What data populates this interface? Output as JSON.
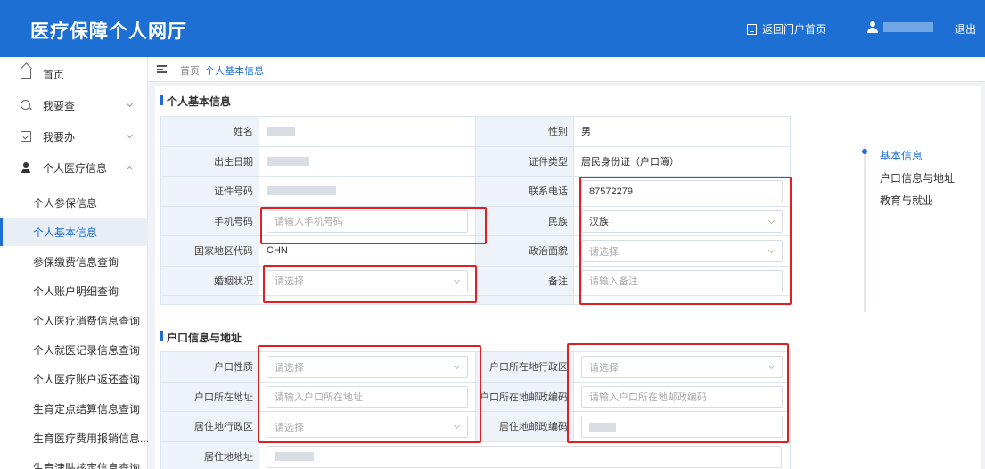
{
  "header": {
    "title": "医疗保障个人网厅",
    "portal_link": "返回门户首页",
    "logout": "退出",
    "bg_color": "#1d6fd3"
  },
  "sidebar": {
    "home": "首页",
    "query": "我要查",
    "handle": "我要办",
    "medical_info": "个人医疗信息",
    "sub_items": [
      "个人参保信息",
      "个人基本信息",
      "参保缴费信息查询",
      "个人账户明细查询",
      "个人医疗消费信息查询",
      "个人就医记录信息查询",
      "个人医疗账户返还查询",
      "生育定点结算信息查询",
      "生育医疗费用报销信息...",
      "生育津贴核定信息查询"
    ],
    "active_index": 1
  },
  "tabs": {
    "home": "首页",
    "active": "个人基本信息",
    "close": "×"
  },
  "basic": {
    "title": "个人基本信息",
    "name_label": "姓名",
    "gender_label": "性别",
    "gender_value": "男",
    "birth_label": "出生日期",
    "cert_type_label": "证件类型",
    "cert_type_value": "居民身份证（户口簿）",
    "cert_no_label": "证件号码",
    "phone_label": "联系电话",
    "phone_value": "87572279",
    "mobile_label": "手机号码",
    "mobile_placeholder": "请输入手机号码",
    "ethnic_label": "民族",
    "ethnic_value": "汉族",
    "country_label": "国家地区代码",
    "country_value": "CHN",
    "political_label": "政治面貌",
    "political_placeholder": "请选择",
    "marital_label": "婚姻状况",
    "marital_placeholder": "请选择",
    "remark_label": "备注",
    "remark_placeholder": "请输入备注"
  },
  "household": {
    "title": "户口信息与地址",
    "hukou_type_label": "户口性质",
    "hukou_type_placeholder": "请选择",
    "hukou_region_label": "户口所在地行政区",
    "hukou_region_placeholder": "请选择",
    "hukou_addr_label": "户口所在地址",
    "hukou_addr_placeholder": "请输入户口所在地址",
    "hukou_zip_label": "户口所在地邮政编码",
    "hukou_zip_placeholder": "请输入户口所在地邮政编码",
    "res_region_label": "居住地行政区",
    "res_region_placeholder": "请选择",
    "res_zip_label": "居住地邮政编码",
    "res_addr_label": "居住地地址"
  },
  "anchor_nav": {
    "items": [
      "基本信息",
      "户口信息与地址",
      "教育与就业"
    ],
    "active_index": 0
  },
  "highlight_color": "#e02020"
}
